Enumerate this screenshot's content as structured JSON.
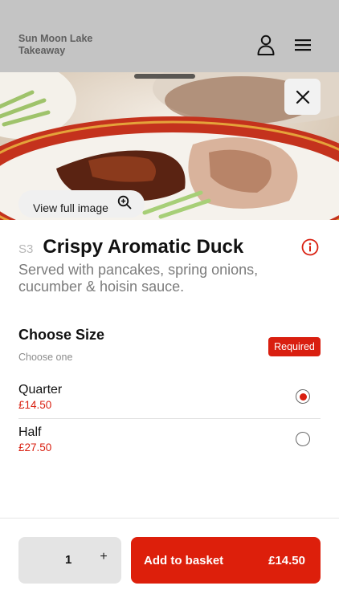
{
  "header": {
    "brand_line1": "Sun Moon Lake",
    "brand_line2": "Takeaway",
    "account_icon": "person-icon",
    "menu_icon": "hamburger-menu-icon"
  },
  "hero": {
    "view_full_image_label": "View full image",
    "zoom_icon": "zoom-in-icon",
    "close_icon": "close-icon"
  },
  "item": {
    "code": "S3",
    "name": "Crispy Aromatic Duck",
    "description": "Served with pancakes, spring onions, cucumber & hoisin sauce.",
    "info_icon": "info-icon"
  },
  "size_section": {
    "title": "Choose Size",
    "subtitle": "Choose one",
    "badge": "Required",
    "options": [
      {
        "name": "Quarter",
        "price": "£14.50",
        "selected": true
      },
      {
        "name": "Half",
        "price": "£27.50",
        "selected": false
      }
    ]
  },
  "footer": {
    "quantity": "1",
    "plus_label": "+",
    "add_label": "Add to basket",
    "total": "£14.50"
  },
  "colors": {
    "accent": "#dd1f0b",
    "header_bg": "#c4c4c4"
  }
}
